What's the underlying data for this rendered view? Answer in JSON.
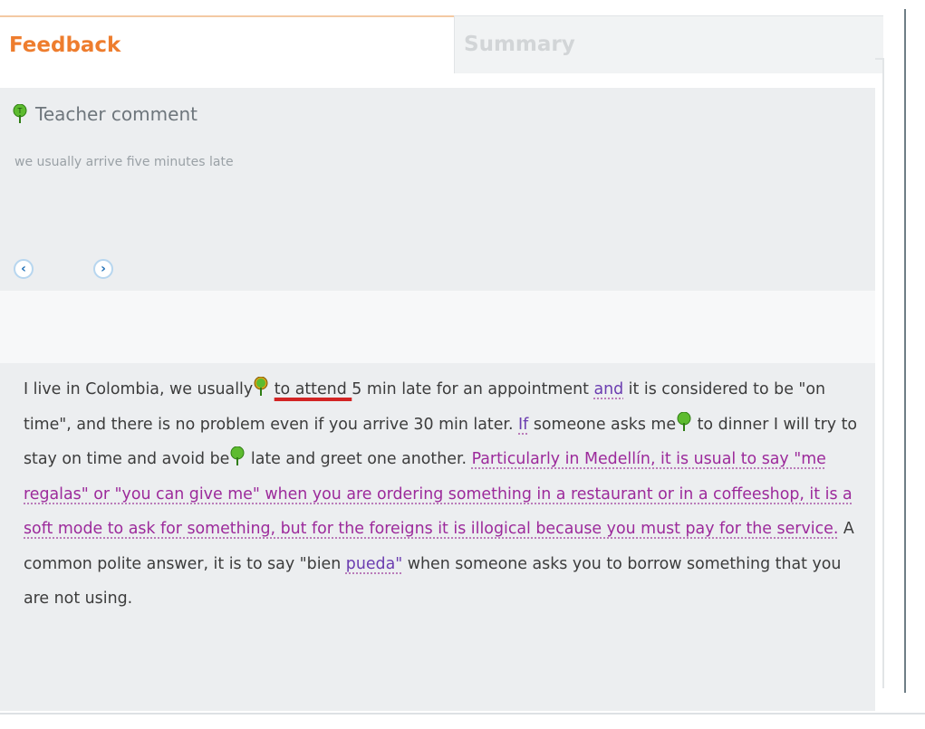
{
  "tabs": {
    "feedback": "Feedback",
    "summary": "Summary"
  },
  "comment": {
    "title": "Teacher comment",
    "text": "we usually arrive five minutes late",
    "icon": "comment-flag-icon",
    "prev_icon": "chevron-left-icon",
    "next_icon": "chevron-right-icon",
    "prev_glyph": "‹",
    "next_glyph": "›"
  },
  "essay": {
    "p1": "I live in Colombia, we usually",
    "err1": "to attend ",
    "p2": "5 min late for an appointment ",
    "h_and": "and",
    "p3": " it is considered to be \"on time\", and there is no problem even if you arrive 30 min later. ",
    "h_if": "If",
    "p4": " someone asks me",
    "p5": " to dinner I will try to stay on time and avoid be",
    "p6": " late and greet one another. ",
    "h_long": "Particularly in Medellín, it is usual to say \"me regalas\" or \"you can give me\" when you are ordering something in a restaurant or in a coffeeshop, it is a soft mode to ask for something, but for the foreigns it is illogical because you must pay for the service.",
    "p7": " A common polite answer, it is to say \"bien ",
    "h_pueda": "pueda\"",
    "p8": " when someone asks you to borrow something that you are not using."
  },
  "colors": {
    "accent": "#ee7d2e",
    "error_underline": "#d22424",
    "highlight": "#9c2a9b",
    "panel": "#eceef0",
    "flag_green": "#5dbb2f"
  }
}
